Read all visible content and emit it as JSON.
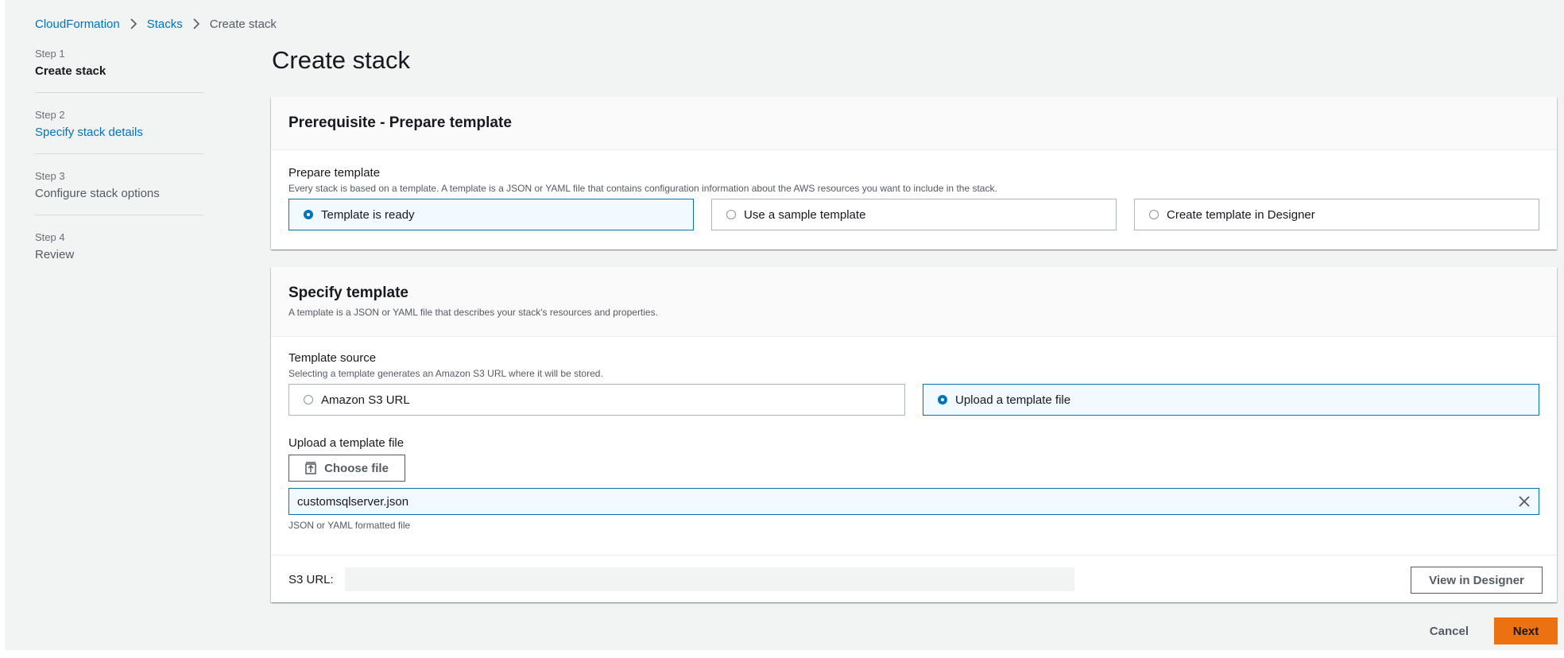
{
  "breadcrumb": {
    "items": [
      "CloudFormation",
      "Stacks"
    ],
    "current": "Create stack"
  },
  "steps": [
    {
      "number": "Step 1",
      "label": "Create stack"
    },
    {
      "number": "Step 2",
      "label": "Specify stack details"
    },
    {
      "number": "Step 3",
      "label": "Configure stack options"
    },
    {
      "number": "Step 4",
      "label": "Review"
    }
  ],
  "page": {
    "title": "Create stack"
  },
  "prerequisite": {
    "title": "Prerequisite - Prepare template",
    "field_label": "Prepare template",
    "field_desc": "Every stack is based on a template. A template is a JSON or YAML file that contains configuration information about the AWS resources you want to include in the stack.",
    "options": [
      "Template is ready",
      "Use a sample template",
      "Create template in Designer"
    ],
    "selected": "Template is ready"
  },
  "specify": {
    "title": "Specify template",
    "desc": "A template is a JSON or YAML file that describes your stack's resources and properties.",
    "source_label": "Template source",
    "source_desc": "Selecting a template generates an Amazon S3 URL where it will be stored.",
    "source_options": [
      "Amazon S3 URL",
      "Upload a template file"
    ],
    "source_selected": "Upload a template file",
    "upload_label": "Upload a template file",
    "choose_file_label": "Choose file",
    "file_name": "customsqlserver.json",
    "file_hint": "JSON or YAML formatted file",
    "s3_url_label": "S3 URL:",
    "view_designer_label": "View in Designer"
  },
  "footer": {
    "cancel_label": "Cancel",
    "next_label": "Next"
  },
  "colors": {
    "link": "#0073bb",
    "primary": "#ec7211",
    "selected_bg": "#f1faff"
  }
}
